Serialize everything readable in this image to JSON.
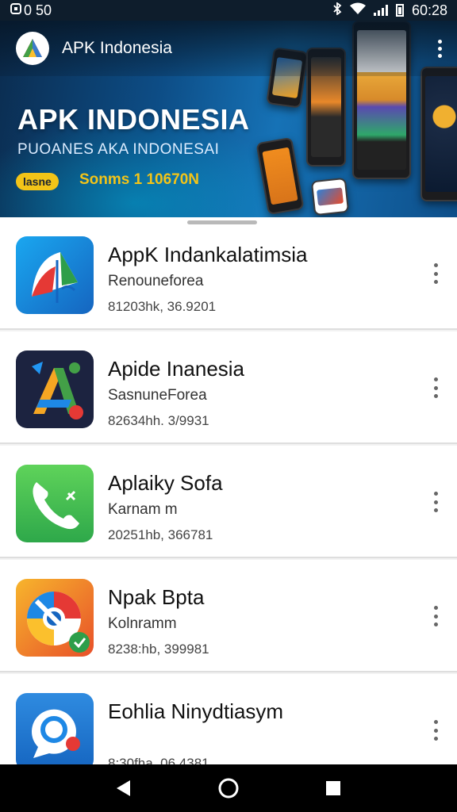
{
  "status_bar": {
    "left_text": "0 50",
    "time": "60:28",
    "icons": [
      "bluetooth-icon",
      "wifi-icon",
      "signal-icon",
      "battery-icon"
    ]
  },
  "toolbar": {
    "title": "APK Indonesia",
    "menu_icon": "more-vert-icon"
  },
  "banner": {
    "title": "APK INDONESIA",
    "subtitle": "PUOANES AKA INDONESAI",
    "badge": "lasne",
    "code": "Sonms 1 10670N"
  },
  "apps": [
    {
      "name": "AppK Indankalatimsia",
      "developer": "Renouneforea",
      "meta": "81203hk, 36.9201",
      "icon": "maps-app-icon"
    },
    {
      "name": "Apide Inanesia",
      "developer": "SasnuneForea",
      "meta": "82634hh. 3/9931",
      "icon": "colorful-a-app-icon"
    },
    {
      "name": "Aplaiky Sofa",
      "developer": "Karnam m",
      "meta": "20251hb, 366781",
      "icon": "phone-app-icon"
    },
    {
      "name": "Npak Bpta",
      "developer": "Kolnramm",
      "meta": "8238:hb, 399981",
      "icon": "chrome-like-app-icon"
    },
    {
      "name": "Eohlia Ninydtiasym",
      "developer": "",
      "meta": "8:30fha, 06.4381",
      "icon": "chat-app-icon"
    }
  ],
  "colors": {
    "banner_accent": "#f2c418",
    "banner_blue": "#0d4d86",
    "status_bar": "#0e1d2c"
  },
  "nav_bar": {
    "back": "back-icon",
    "home": "home-icon",
    "recents": "recents-icon"
  }
}
